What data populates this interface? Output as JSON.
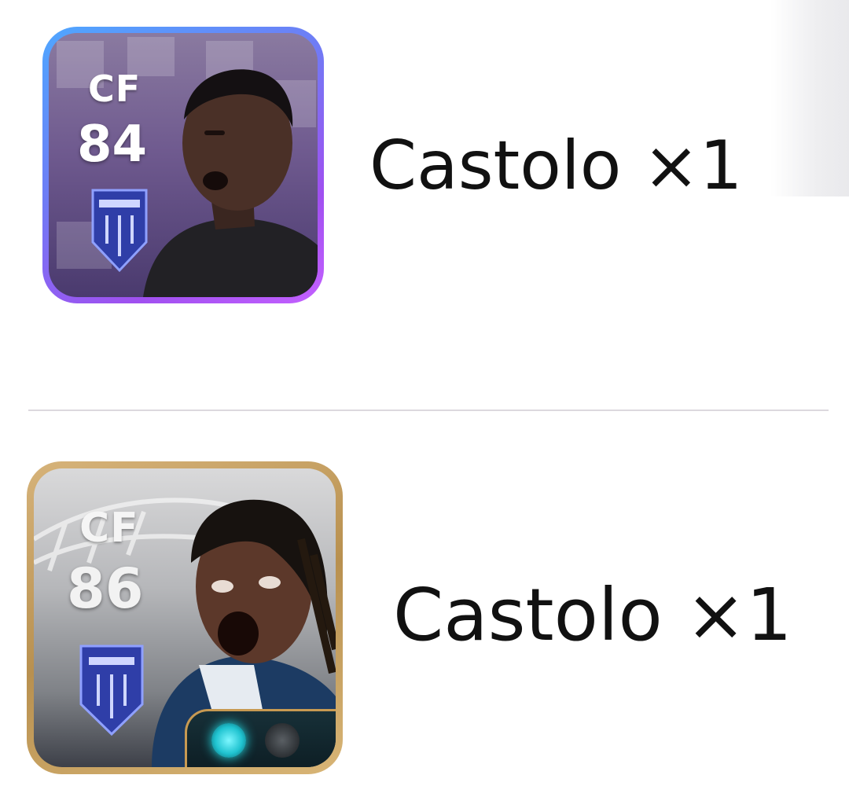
{
  "rewards": [
    {
      "position": "CF",
      "rating": "84",
      "name": "Castolo",
      "quantity": "×1",
      "label": "Castolo ×1",
      "frame_color": "#8f6cf2",
      "icon": "player-card-icon"
    },
    {
      "position": "CF",
      "rating": "86",
      "name": "Castolo",
      "quantity": "×1",
      "label": "Castolo ×1",
      "frame_color": "#c9a164",
      "icon": "player-card-icon"
    }
  ]
}
